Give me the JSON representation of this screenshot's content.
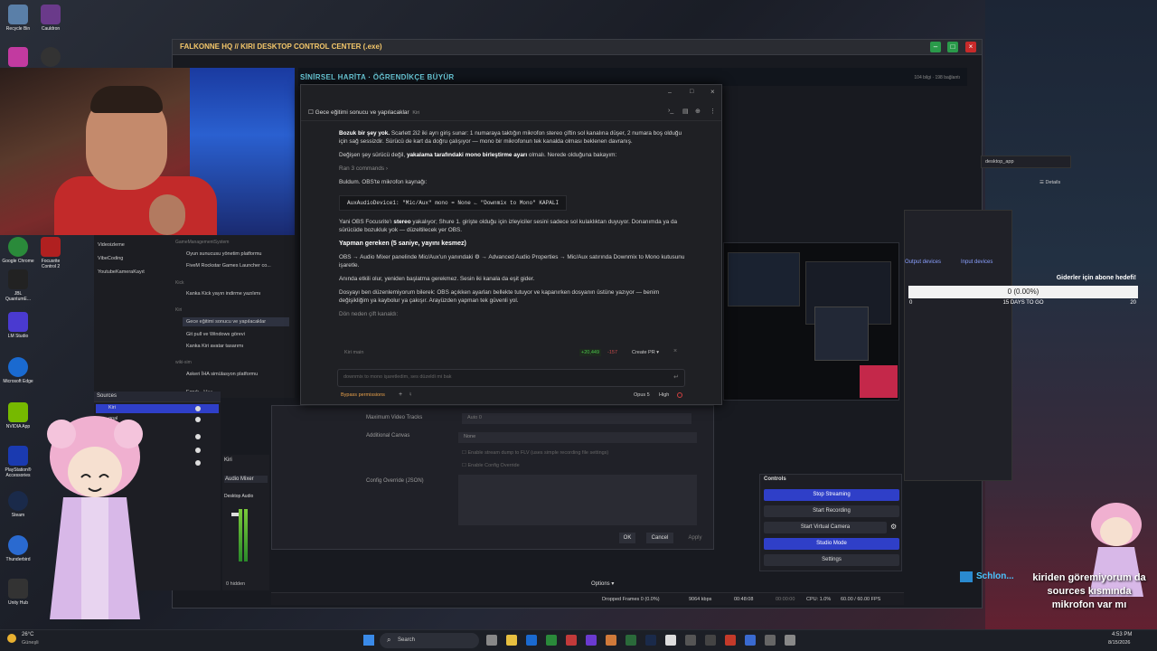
{
  "desktop": {
    "icons": [
      {
        "label": "Recycle Bin",
        "color": "#5a7fa8"
      },
      {
        "label": "Cauldron",
        "color": "#6a3a8a"
      },
      {
        "label": "",
        "color": "#c23aa0"
      },
      {
        "label": "",
        "color": "#333"
      },
      {
        "label": "Google Chrome",
        "color": "#2a8a3a"
      },
      {
        "label": "Focusrite Control 2",
        "color": "#b02020"
      },
      {
        "label": "JBL QuantumE...",
        "color": "#222"
      },
      {
        "label": "LM Studio",
        "color": "#4a3ad0"
      },
      {
        "label": "Microsoft Edge",
        "color": "#1a6ad0"
      },
      {
        "label": "NVIDIA App",
        "color": "#76b900"
      },
      {
        "label": "PlayStation® Accessories",
        "color": "#1a3ab0"
      },
      {
        "label": "Steam",
        "color": "#1a2a4a"
      },
      {
        "label": "Thunderbird",
        "color": "#2a6ad0"
      },
      {
        "label": "Unity Hub",
        "color": "#333"
      }
    ]
  },
  "main_window": {
    "title": "FALKONNE HQ // KIRI DESKTOP CONTROL CENTER (.exe)",
    "map_header": "SİNİRSEL HARİTA · ÖĞRENDİKÇE BÜYÜR",
    "map_stats": "104 bilgi · 198 bağlantı"
  },
  "chat": {
    "title": "Gece eğitimi sonucu ve yapılacaklar",
    "title_tag": "Kiri",
    "p1_bold": "Bozuk bir şey yok.",
    "p1_text": " Scarlett 2i2 iki ayrı giriş sunar: 1 numaraya taktığın mikrofon stereo çiftin sol kanalına düşer, 2 numara boş olduğu için sağ sessizdir. Sürücü de kart da doğru çalışıyor — mono bir mikrofonun tek kanalda olması beklenen davranış.",
    "p2_text": "Değişen şey sürücü değil, ",
    "p2_bold": "yakalama tarafındaki mono birleştirme ayarı",
    "p2_end": " olmalı. Nerede olduğuna bakayım:",
    "ran_commands": "Ran 3 commands",
    "found_text": "Buldum. OBS'te mikrofon kaynağı:",
    "code_line": "AuxAudioDevice1: \"Mic/Aux\"   mono = None   ← \"Downmix to Mono\" KAPALI",
    "p3_text": "Yani OBS Focusrite'ı ",
    "p3_bold": "stereo",
    "p3_end": " yakalıyor; Shure 1. girişte olduğu için izleyiciler sesini sadece sol kulaklıktan duyuyor. Donanımda ya da sürücüde bozukluk yok — düzeltilecek yer OBS.",
    "heading": "Yapman gereken (5 saniye, yayını kesmez)",
    "step_text": "OBS → Audio Mixer panelinde Mic/Aux'un yanındaki ⚙ → Advanced Audio Properties → Mic/Aux satırında Downmix to Mono kutusunu işaretle.",
    "p4_text": "Anında etkili olur, yeniden başlatma gerekmez. Sesin iki kanala da eşit gider.",
    "p5_text": "Dosyayı ben düzenlemiyorum bilerek: OBS açıkken ayarları bellekte tutuyor ve kapanırken dosyanın üstüne yazıyor — benim değişikliğim ya kaybolur ya çakışır. Arayüzden yapman tek güvenli yol.",
    "collapsed": "Dön neden çift kanaldı:",
    "branch_left": "Kiri  main",
    "diff_plus": "+20,449",
    "diff_minus": "-157",
    "create_pr": "Create PR",
    "input_placeholder": "downmix to mono işaretledim, ses düzeldi mi bak",
    "bypass": "Bypass permissions",
    "model": "Opus 5",
    "effort": "High"
  },
  "sidebar": {
    "items_left": [
      "Videoizleme",
      "VibeCoding",
      "YoutubeKameraKayıt"
    ],
    "group1": "GameManagementSystem",
    "g1_items": [
      "Oyun sunucusu yönetim platformu",
      "FiveM Rockstar Games Launcher co..."
    ],
    "group2": "Kick",
    "g2_items": [
      "Kanka Kick yayın indirme yazılımı"
    ],
    "group3": "Kiri",
    "g3_items": [
      "Gece eğitimi sonucu ve yapılacaklar",
      "Git pull ve Windows görevi",
      "Kanka Kiri avatar tasarımı"
    ],
    "group4": "wiki-sim",
    "g4_items": [
      "Askeri İHA simülasyon platformu"
    ],
    "user": "Faruk",
    "user_plan": "Max"
  },
  "obs": {
    "sources_label": "Sources",
    "sources": [
      "Kiri",
      "goal"
    ],
    "audio_mixer": "Audio Mixer",
    "mixer_device": "Desktop Audio",
    "hidden_count": "0 hidden",
    "kiri_label": "Kiri",
    "settings_rows": [
      {
        "label": "Maximum Video Tracks",
        "value": "Auto   0"
      },
      {
        "label": "Additional Canvas",
        "value": "None"
      }
    ],
    "checkbox1": "Enable stream dump to FLV (uses simple recording file settings)",
    "checkbox2": "Enable Config Override",
    "config_label": "Config Override (JSON)",
    "ok": "OK",
    "cancel": "Cancel",
    "apply": "Apply",
    "controls_label": "Controls",
    "controls": [
      "Stop Streaming",
      "Start Recording",
      "Start Virtual Camera",
      "Studio Mode",
      "Settings"
    ],
    "options": "Options",
    "status": {
      "dropped": "Dropped Frames 0 (0.0%)",
      "kbps": "9064 kbps",
      "live_time": "00:48:08",
      "rec_time": "00:00:00",
      "cpu": "CPU: 1.0%",
      "fps": "60.00 / 60.00 FPS"
    }
  },
  "audio_panel": {
    "tabs": [
      "Output devices",
      "Input devices"
    ],
    "search": "desktop_app",
    "details": "Details"
  },
  "goal": {
    "title": "Giderler için abone hedefi!",
    "value": "0 (0.00%)",
    "left": "0",
    "middle": "15 DAYS TO GO",
    "right": "20",
    "progress": 0.0
  },
  "overlay_chat": {
    "user": "Schlon...",
    "message": "kiriden göremiyorum da sources kısmında mikrofon var mı"
  },
  "taskbar": {
    "weather_temp": "26°C",
    "weather_desc": "Güneşli",
    "search": "Search",
    "time": "4:53 PM",
    "date": "8/15/2026"
  }
}
